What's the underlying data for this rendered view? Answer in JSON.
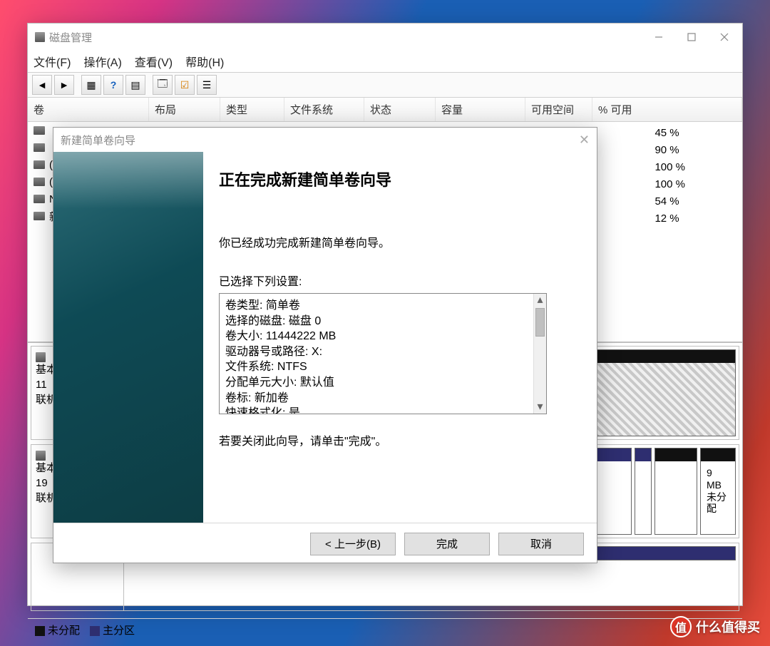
{
  "window": {
    "title": "磁盘管理",
    "controls": {
      "min": "minimize",
      "max": "maximize",
      "close": "close"
    }
  },
  "menu": {
    "file": "文件(F)",
    "action": "操作(A)",
    "view": "查看(V)",
    "help": "帮助(H)"
  },
  "columns": {
    "vol": "卷",
    "layout": "布局",
    "type": "类型",
    "fs": "文件系统",
    "status": "状态",
    "cap": "容量",
    "free": "可用空间",
    "pct": "% 可用"
  },
  "pcts": [
    "45 %",
    "90 %",
    "100 %",
    "100 %",
    "54 %",
    "12 %"
  ],
  "row_labels": [
    "",
    "",
    "(",
    "(",
    "N",
    "新"
  ],
  "disk0": {
    "label": "基本",
    "size": "11",
    "status": "联机"
  },
  "disk1": {
    "label": "基本",
    "size": "19",
    "status": "联机"
  },
  "part_small": {
    "size": "9 MB",
    "stat": "未分配"
  },
  "legend": {
    "unalloc": "未分配",
    "primary": "主分区"
  },
  "dialog": {
    "title": "新建简单卷向导",
    "heading": "正在完成新建简单卷向导",
    "success": "你已经成功完成新建简单卷向导。",
    "selected": "已选择下列设置:",
    "settings": [
      "卷类型: 简单卷",
      "选择的磁盘: 磁盘 0",
      "卷大小: 11444222 MB",
      "驱动器号或路径: X:",
      "文件系统: NTFS",
      "分配单元大小: 默认值",
      "卷标: 新加卷",
      "快速格式化: 是"
    ],
    "hint": "若要关闭此向导，请单击\"完成\"。",
    "back": "< 上一步(B)",
    "finish": "完成",
    "cancel": "取消"
  },
  "watermark": "什么值得买"
}
